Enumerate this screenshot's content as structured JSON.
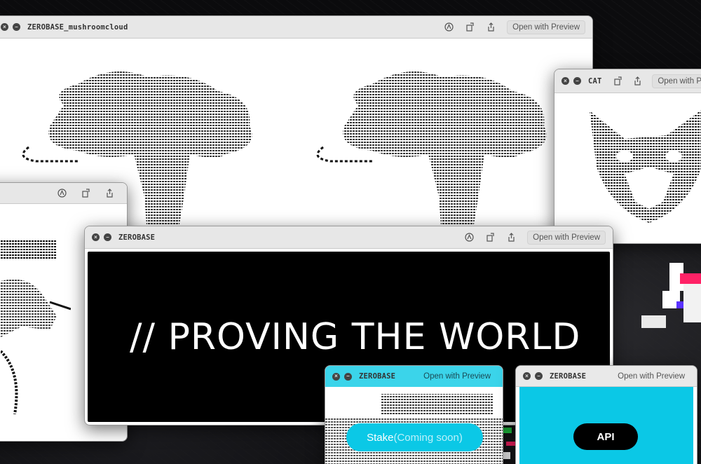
{
  "windows": {
    "mushroom": {
      "title": "ZEROBASE_mushroomcloud",
      "open_label": "Open with Preview"
    },
    "cat": {
      "title": "CAT",
      "open_label": "Open with P"
    },
    "face": {
      "title": ""
    },
    "main": {
      "title": "ZEROBASE",
      "open_label": "Open with Preview",
      "headline": "// PROVING THE WORLD"
    },
    "stake": {
      "title": "ZEROBASE",
      "open_label": "Open with Preview",
      "button_label": "Stake",
      "button_suffix": " (Coming soon)"
    },
    "api": {
      "title": "ZEROBASE",
      "open_label": "Open with Preview",
      "button_label": "API"
    }
  },
  "icons": [
    "close-icon",
    "minimize-icon",
    "markup-icon",
    "rotate-icon",
    "share-icon"
  ],
  "colors": {
    "accent": "#0bc8e6",
    "window_chrome": "#e7e7e7",
    "background": "#0c0c0e"
  }
}
